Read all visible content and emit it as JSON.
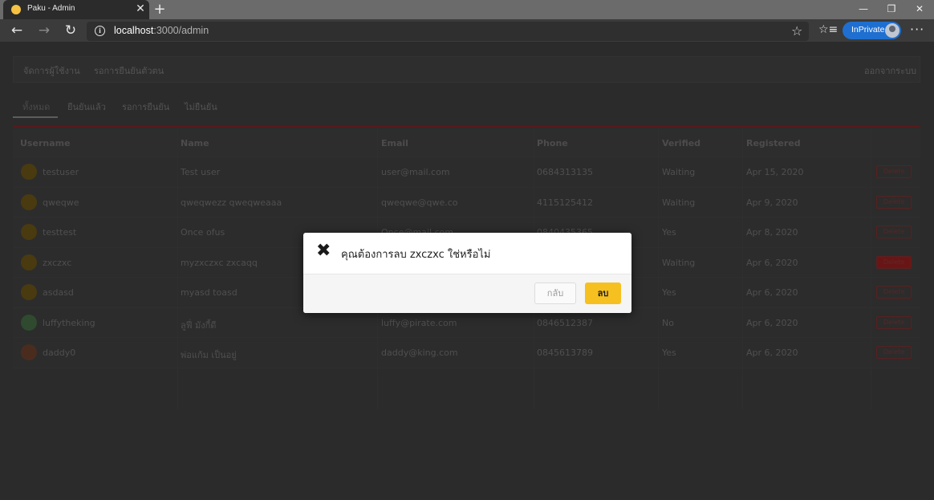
{
  "browser": {
    "tab_title": "Paku - Admin",
    "tab_close": "✕",
    "new_tab": "+",
    "url_host": "localhost",
    "url_path": ":3000/admin",
    "inprivate_label": "InPrivate",
    "more": "···"
  },
  "topnav": {
    "manage_users": "จัดการผู้ใช้งาน",
    "pending_verification": "รอการยืนยันตัวตน",
    "logout": "ออกจากระบบ"
  },
  "filter_tabs": [
    {
      "label": "ทั้งหมด",
      "active": true
    },
    {
      "label": "ยืนยันแล้ว",
      "active": false
    },
    {
      "label": "รอการยืนยัน",
      "active": false
    },
    {
      "label": "ไม่ยืนยัน",
      "active": false
    }
  ],
  "table": {
    "headers": [
      "Username",
      "Name",
      "Email",
      "Phone",
      "Verified",
      "Registered"
    ],
    "delete_label": "Delete",
    "rows": [
      {
        "username": "testuser",
        "name": "Test user",
        "email": "user@mail.com",
        "phone": "0684313135",
        "verified": "Waiting",
        "registered": "Apr 15, 2020"
      },
      {
        "username": "qweqwe",
        "name": "qweqwezz qweqweaaa",
        "email": "qweqwe@qwe.co",
        "phone": "4115125412",
        "verified": "Waiting",
        "registered": "Apr 9, 2020"
      },
      {
        "username": "testtest",
        "name": "Once ofus",
        "email": "Once@mail.com",
        "phone": "0840435365",
        "verified": "Yes",
        "registered": "Apr 8, 2020"
      },
      {
        "username": "zxczxc",
        "name": "myzxczxc zxcaqq",
        "email": "",
        "phone": "",
        "verified": "Waiting",
        "registered": "Apr 6, 2020"
      },
      {
        "username": "asdasd",
        "name": "myasd toasd",
        "email": "",
        "phone": "",
        "verified": "Yes",
        "registered": "Apr 6, 2020"
      },
      {
        "username": "luffytheking",
        "name": "ลูฟี่ มังกี้ดี",
        "email": "luffy@pirate.com",
        "phone": "0846512387",
        "verified": "No",
        "registered": "Apr 6, 2020"
      },
      {
        "username": "daddy0",
        "name": "พ่อแก้ม เป็นอยู่",
        "email": "daddy@king.com",
        "phone": "0845613789",
        "verified": "Yes",
        "registered": "Apr 6, 2020"
      }
    ]
  },
  "modal": {
    "icon": "✖",
    "message": "คุณต้องการลบ zxczxc ใช่หรือไม่",
    "back_label": "กลับ",
    "delete_label": "ลบ"
  },
  "colors": {
    "accent_yellow": "#f6c021",
    "inprivate_blue": "#1f6fd0",
    "divider_red": "#5a1a1a"
  }
}
